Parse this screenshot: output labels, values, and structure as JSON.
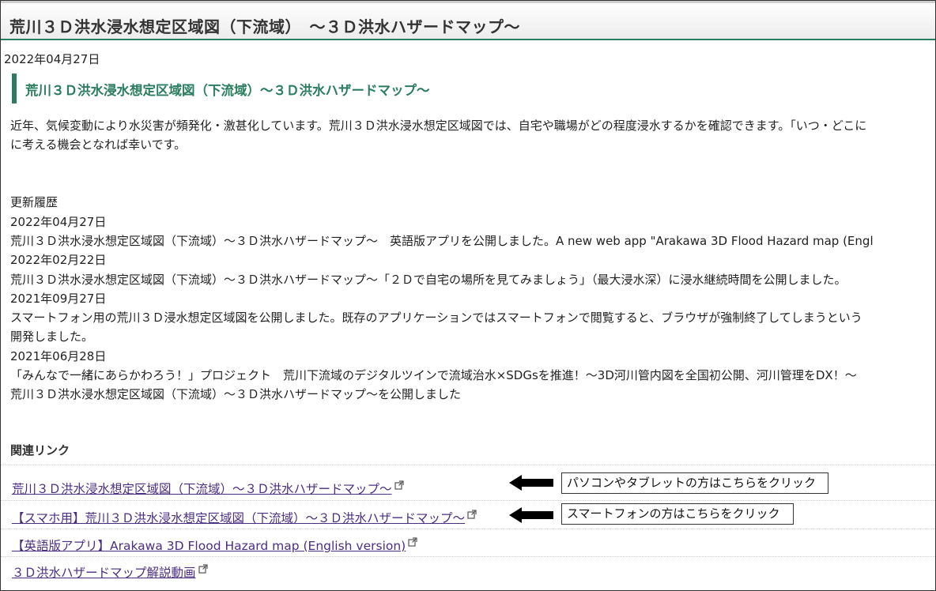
{
  "header": {
    "title": "荒川３Ｄ洪水浸水想定区域図（下流域）　～３Ｄ洪水ハザードマップ～"
  },
  "date": "2022年04月27日",
  "subtitle": "荒川３Ｄ洪水浸水想定区域図（下流域）～３Ｄ洪水ハザードマップ～",
  "intro": [
    "近年、気候変動により水災害が頻発化・激甚化しています。荒川３Ｄ洪水浸水想定区域図では、自宅や職場がどの程度浸水するかを確認できます。「いつ・どこに",
    "に考える機会となれば幸いです。"
  ],
  "history": {
    "heading": "更新履歴",
    "lines": [
      "2022年04月27日",
      "荒川３Ｄ洪水浸水想定区域図（下流域）～３Ｄ洪水ハザードマップ～　英語版アプリを公開しました。A new web app \"Arakawa 3D Flood Hazard map (Engl",
      "2022年02月22日",
      "荒川３Ｄ洪水浸水想定区域図（下流域）～３Ｄ洪水ハザードマップ～「２Ｄで自宅の場所を見てみましょう」（最大浸水深）に浸水継続時間を公開しました。",
      "2021年09月27日",
      "スマートフォン用の荒川３Ｄ浸水想定区域図を公開しました。既存のアプリケーションではスマートフォンで閲覧すると、ブラウザが強制終了してしまうという",
      "開発しました。",
      "2021年06月28日",
      "「みんなで一緒にあらかわろう！」プロジェクト　荒川下流域のデジタルツインで流域治水×SDGsを推進！～3D河川管内図を全国初公開、河川管理をDX！～",
      "荒川３Ｄ洪水浸水想定区域図（下流域）～３Ｄ洪水ハザードマップ～を公開しました"
    ]
  },
  "related": {
    "heading": "関連リンク",
    "links": [
      {
        "label": "荒川３Ｄ洪水浸水想定区域図（下流域）～３Ｄ洪水ハザードマップ～"
      },
      {
        "label": "【スマホ用】荒川３Ｄ洪水浸水想定区域図（下流域）～３Ｄ洪水ハザードマップ～"
      },
      {
        "label": "【英語版アプリ】Arakawa 3D Flood Hazard map (English version)"
      },
      {
        "label": "３Ｄ洪水ハザードマップ解説動画"
      }
    ]
  },
  "callouts": {
    "pc": "パソコンやタブレットの方はこちらをクリック",
    "smartphone": "スマートフォンの方はこちらをクリック"
  },
  "colors": {
    "accent": "#2a7d5f",
    "link": "#4b2e83"
  }
}
